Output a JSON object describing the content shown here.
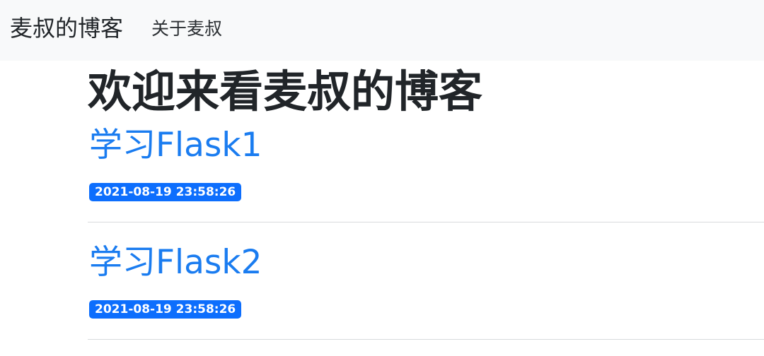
{
  "navbar": {
    "brand": "麦叔的博客",
    "links": [
      {
        "label": "关于麦叔"
      }
    ]
  },
  "main": {
    "title": "欢迎来看麦叔的博客",
    "posts": [
      {
        "title": "学习Flask1",
        "date": "2021-08-19 23:58:26"
      },
      {
        "title": "学习Flask2",
        "date": "2021-08-19 23:58:26"
      }
    ]
  },
  "colors": {
    "navbar_bg": "#f8f9fa",
    "link": "#1a7cf0",
    "badge_bg": "#0d6efd",
    "text": "#212529",
    "divider": "#d8dadd"
  }
}
